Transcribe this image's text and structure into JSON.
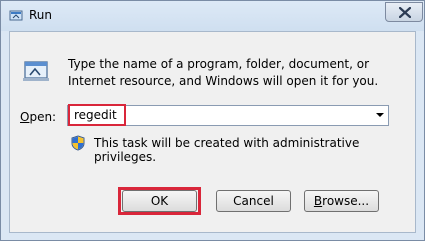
{
  "window": {
    "title": "Run"
  },
  "dialog": {
    "description": "Type the name of a program, folder, document, or Internet resource, and Windows will open it for you.",
    "open_label_underlined": "O",
    "open_label_rest": "pen:",
    "open_value": "regedit",
    "admin_notice": "This task will be created with administrative privileges."
  },
  "buttons": {
    "ok": "OK",
    "cancel": "Cancel",
    "browse_underlined": "B",
    "browse_rest": "rowse..."
  },
  "icons": {
    "app": "run-window-icon",
    "run": "run-program-icon",
    "shield": "uac-shield-icon",
    "close": "close-icon",
    "dropdown": "chevron-down-icon"
  },
  "colors": {
    "highlight": "#d9263a",
    "client_background": "#f0f0f0",
    "frame": "#dbe7f4"
  }
}
